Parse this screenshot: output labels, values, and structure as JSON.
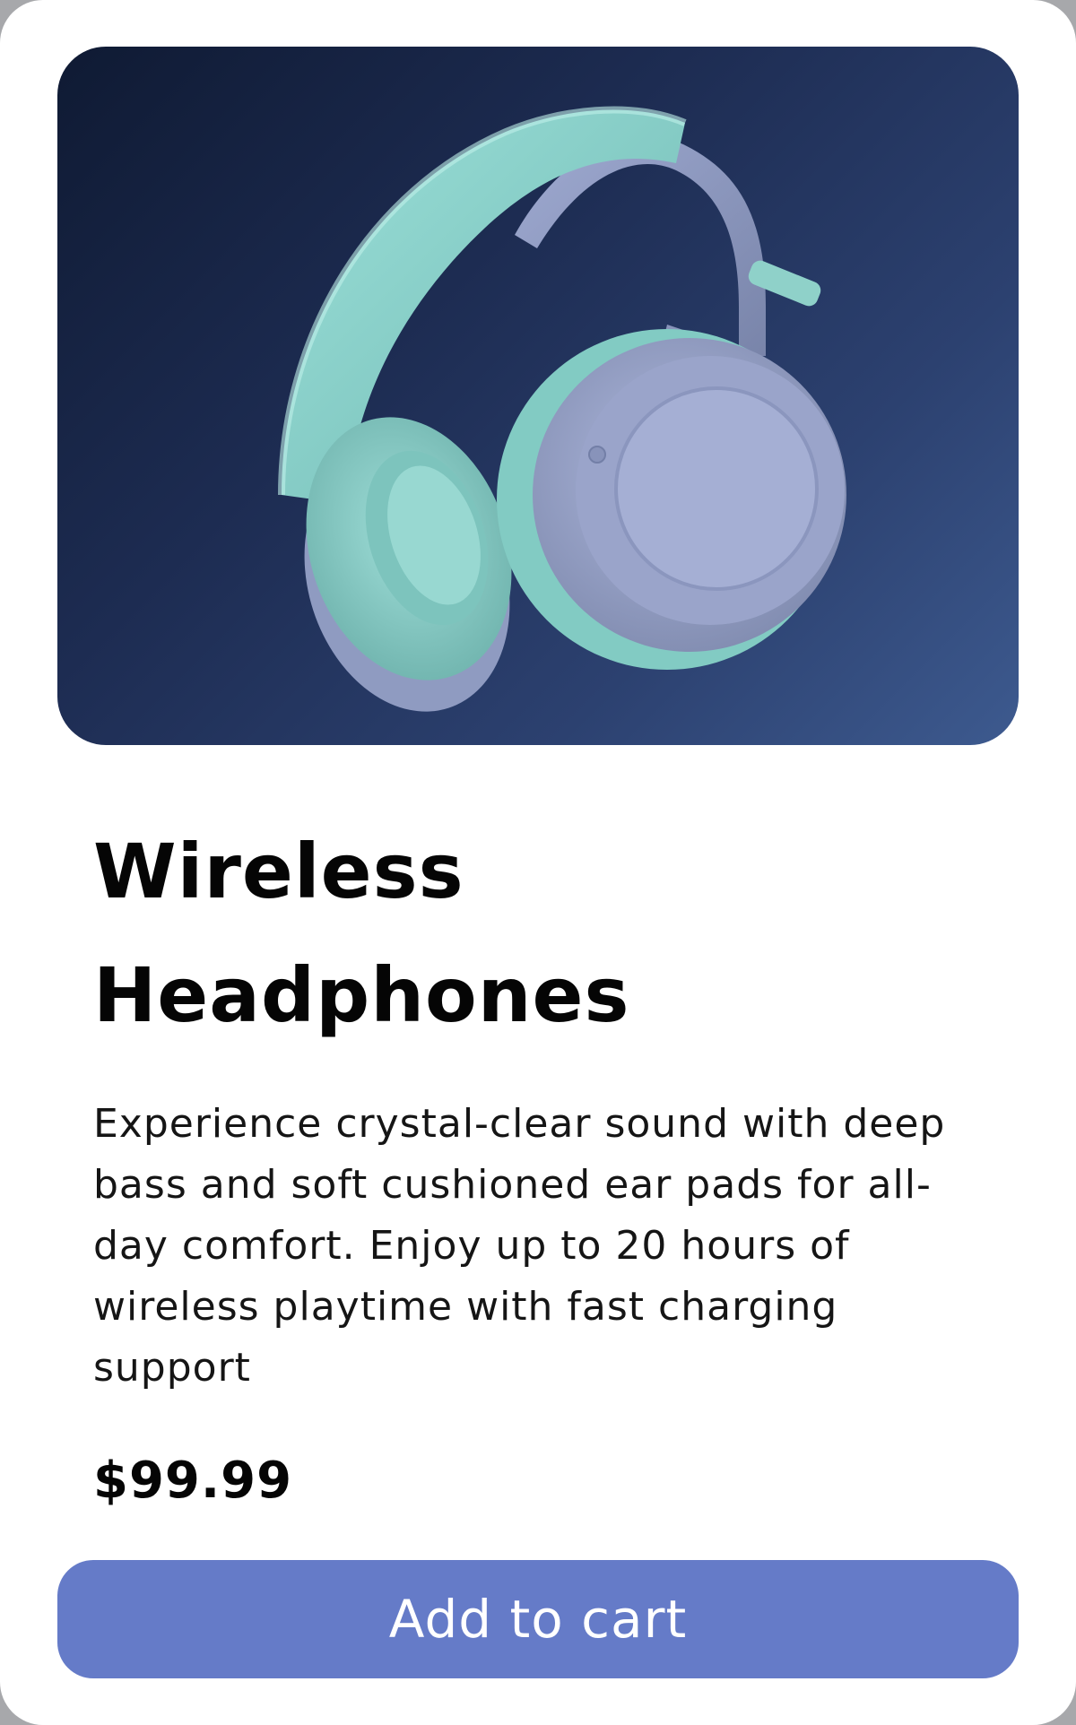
{
  "product": {
    "image_icon": "headphones-icon",
    "title": "Wireless Headphones",
    "description": "Experience crystal-clear sound with deep bass and soft cushioned ear pads for all-day comfort. Enjoy up to 20 hours of wireless playtime with fast charging support",
    "price": "$99.99",
    "add_to_cart_label": "Add to cart"
  },
  "colors": {
    "button": "#657bc8",
    "hero_dark": "#0f1a33",
    "hero_light": "#3d5a8f",
    "headphone_body": "#8f9bc1",
    "headphone_cushion": "#8fd1c9"
  }
}
